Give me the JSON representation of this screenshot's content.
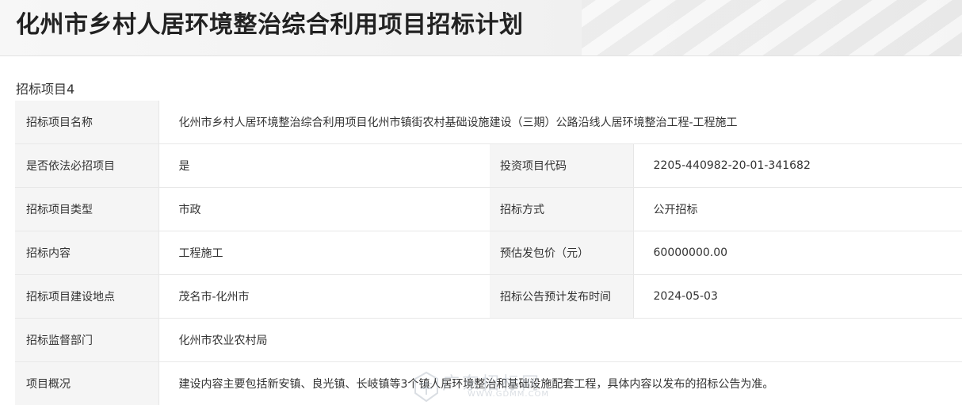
{
  "page": {
    "title": "化州市乡村人居环境整治综合利用项目招标计划"
  },
  "section": {
    "label": "招标项目4"
  },
  "rows": {
    "name": {
      "label": "招标项目名称",
      "value": "化州市乡村人居环境整治综合利用项目化州市镇街农村基础设施建设（三期）公路沿线人居环境整治工程-工程施工"
    },
    "mandatory": {
      "label": "是否依法必招项目",
      "value": "是",
      "label2": "投资项目代码",
      "value2": "2205-440982-20-01-341682"
    },
    "type": {
      "label": "招标项目类型",
      "value": "市政",
      "label2": "招标方式",
      "value2": "公开招标"
    },
    "content": {
      "label": "招标内容",
      "value": "工程施工",
      "label2": "预估发包价（元）",
      "value2": "60000000.00"
    },
    "location": {
      "label": "招标项目建设地点",
      "value": "茂名市-化州市",
      "label2": "招标公告预计发布时间",
      "value2": "2024-05-03"
    },
    "supervisor": {
      "label": "招标监督部门",
      "value": "化州市农业农村局"
    },
    "overview": {
      "label": "项目概况",
      "value": "建设内容主要包括新安镇、良光镇、长岐镇等3个镇人居环境整治和基础设施配套工程，具体内容以发布的招标公告为准。"
    }
  },
  "watermark": {
    "text": "广东招标网",
    "url": "WWW.GDMM.COM"
  }
}
